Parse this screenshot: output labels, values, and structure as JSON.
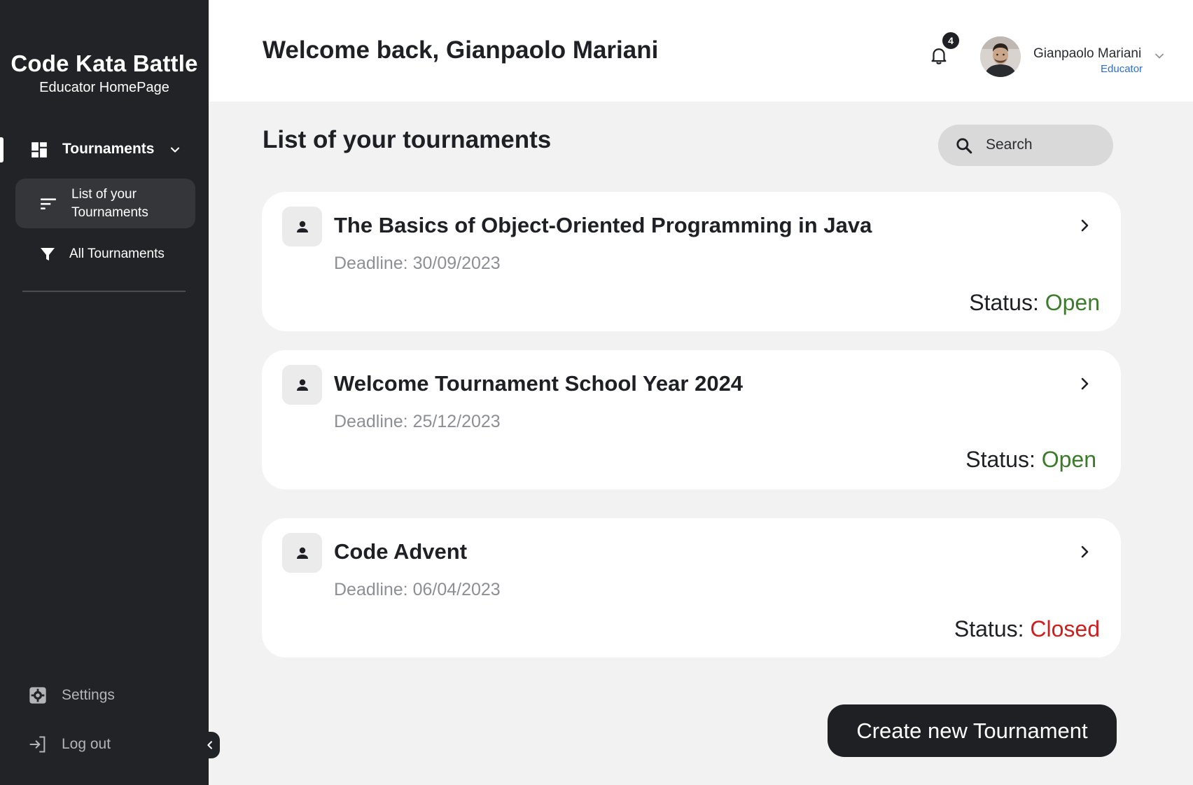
{
  "brand": {
    "title": "Code Kata Battle",
    "subtitle": "Educator HomePage"
  },
  "sidebar": {
    "group": {
      "label": "Tournaments",
      "icon": "dashboard-icon"
    },
    "items": [
      {
        "label": "List of your Tournaments",
        "icon": "sort-list-icon",
        "active": true
      },
      {
        "label": "All Tournaments",
        "icon": "filter-icon",
        "active": false
      }
    ],
    "settings": "Settings",
    "logout": "Log out"
  },
  "header": {
    "welcome": "Welcome back, Gianpaolo Mariani",
    "notifications_count": "4",
    "user_name": "Gianpaolo Mariani",
    "user_role": "Educator"
  },
  "main": {
    "section_title": "List of your tournaments",
    "search_placeholder": "Search",
    "status_prefix": "Status: ",
    "tournaments": [
      {
        "title": "The Basics of Object-Oriented Programming in Java",
        "deadline": "Deadline: 30/09/2023",
        "status": "Open"
      },
      {
        "title": "Welcome Tournament School Year 2024",
        "deadline": "Deadline: 25/12/2023",
        "status": "Open"
      },
      {
        "title": "Code Advent",
        "deadline": "Deadline: 06/04/2023",
        "status": "Closed"
      }
    ],
    "create_button": "Create new Tournament"
  },
  "colors": {
    "sidebar_bg": "#222326",
    "status_open": "#3c7a2c",
    "status_closed": "#d01e1e",
    "role_link": "#2f6bd6"
  }
}
